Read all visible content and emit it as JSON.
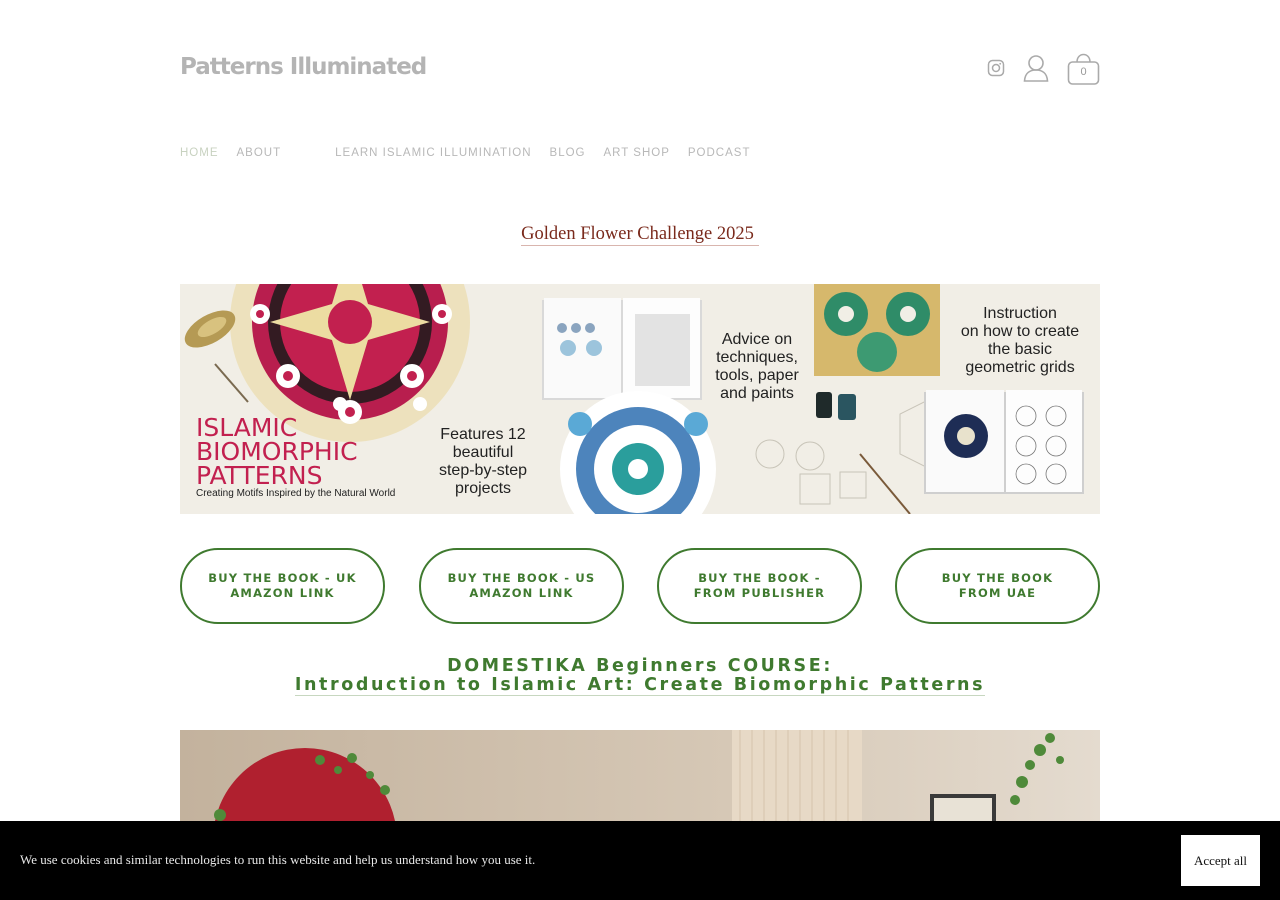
{
  "header": {
    "logo": "Patterns Illuminated",
    "cart_count": "0",
    "icons": [
      "instagram-icon",
      "account-icon",
      "cart-icon"
    ]
  },
  "nav": {
    "items": [
      "HOME",
      "ABOUT",
      "LEARN ISLAMIC ILLUMINATION",
      "BLOG",
      "ART SHOP",
      "PODCAST"
    ],
    "active": "HOME"
  },
  "challenge_link": "Golden Flower Challenge 2025",
  "banner": {
    "title_lines": [
      "ISLAMIC",
      "BIOMORPHIC",
      "PATTERNS"
    ],
    "subtitle": "Creating Motifs Inspired by the Natural World",
    "feature_lines": [
      "Features 12",
      "beautiful",
      "step-by-step",
      "projects"
    ],
    "advice_lines": [
      "Advice on",
      "techniques,",
      "tools, paper",
      "and paints"
    ],
    "instruction_lines": [
      "Instruction",
      "on how to create",
      "the basic",
      "geometric grids"
    ]
  },
  "buttons": [
    {
      "line1": "BUY THE BOOK - UK",
      "line2": "AMAZON LINK"
    },
    {
      "line1": "BUY THE BOOK - US",
      "line2": "AMAZON LINK"
    },
    {
      "line1": "BUY THE BOOK -",
      "line2": "FROM PUBLISHER"
    },
    {
      "line1": "BUY THE BOOK",
      "line2": "FROM UAE"
    }
  ],
  "course": {
    "line1": "DOMESTIKA Beginners COURSE:",
    "line2": "Introduction to Islamic Art: Create Biomorphic Patterns"
  },
  "cookie": {
    "text": "We use cookies and similar technologies to run this website and help us understand how you use it.",
    "accept_label": "Accept all"
  },
  "colors": {
    "accent_green": "#3f7a2f",
    "challenge_red": "#7a2a1c",
    "logo_gray": "#b4b4b4",
    "cookie_bg": "#000000"
  }
}
